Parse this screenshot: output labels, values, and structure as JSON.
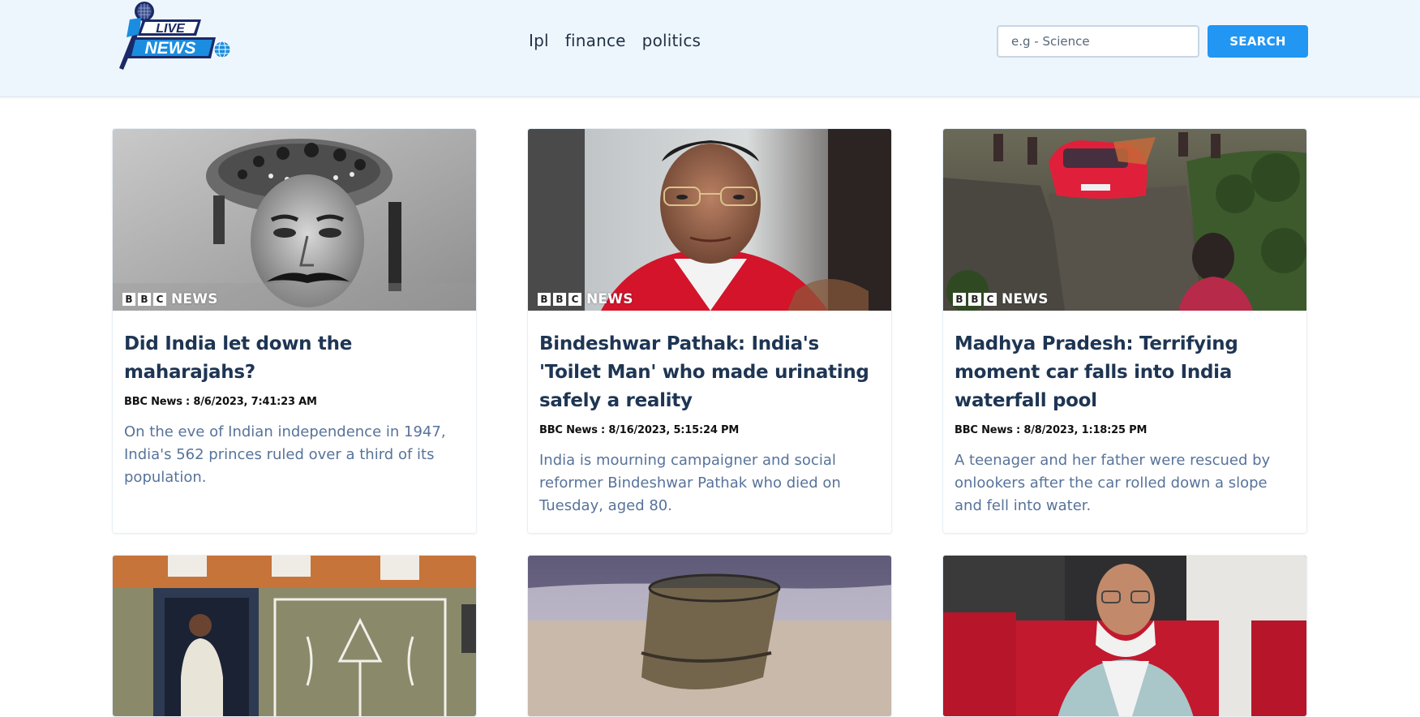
{
  "header": {
    "logo": {
      "line1": "LIVE",
      "line2": "NEWS"
    },
    "nav": [
      {
        "label": "Ipl"
      },
      {
        "label": "finance"
      },
      {
        "label": "politics"
      }
    ],
    "search": {
      "placeholder": "e.g - Science",
      "value": "",
      "button_label": "SEARCH"
    }
  },
  "colors": {
    "accent": "#2196f3",
    "title": "#1e3553",
    "description": "#57739a",
    "header_bg": "#eef6fd"
  },
  "articles": [
    {
      "source_badge": {
        "letters": [
          "B",
          "B",
          "C"
        ],
        "word": "NEWS"
      },
      "title": "Did India let down the maharajahs?",
      "meta": "BBC News : 8/6/2023, 7:41:23 AM",
      "description": "On the eve of Indian independence in 1947, India's 562 princes ruled over a third of its population."
    },
    {
      "source_badge": {
        "letters": [
          "B",
          "B",
          "C"
        ],
        "word": "NEWS"
      },
      "title": "Bindeshwar Pathak: India's 'Toilet Man' who made urinating safely a reality",
      "meta": "BBC News : 8/16/2023, 5:15:24 PM",
      "description": "India is mourning campaigner and social reformer Bindeshwar Pathak who died on Tuesday, aged 80."
    },
    {
      "source_badge": {
        "letters": [
          "B",
          "B",
          "C"
        ],
        "word": "NEWS"
      },
      "title": "Madhya Pradesh: Terrifying moment car falls into India waterfall pool",
      "meta": "BBC News : 8/8/2023, 1:18:25 PM",
      "description": "A teenager and her father were rescued by onlookers after the car rolled down a slope and fell into water."
    }
  ]
}
